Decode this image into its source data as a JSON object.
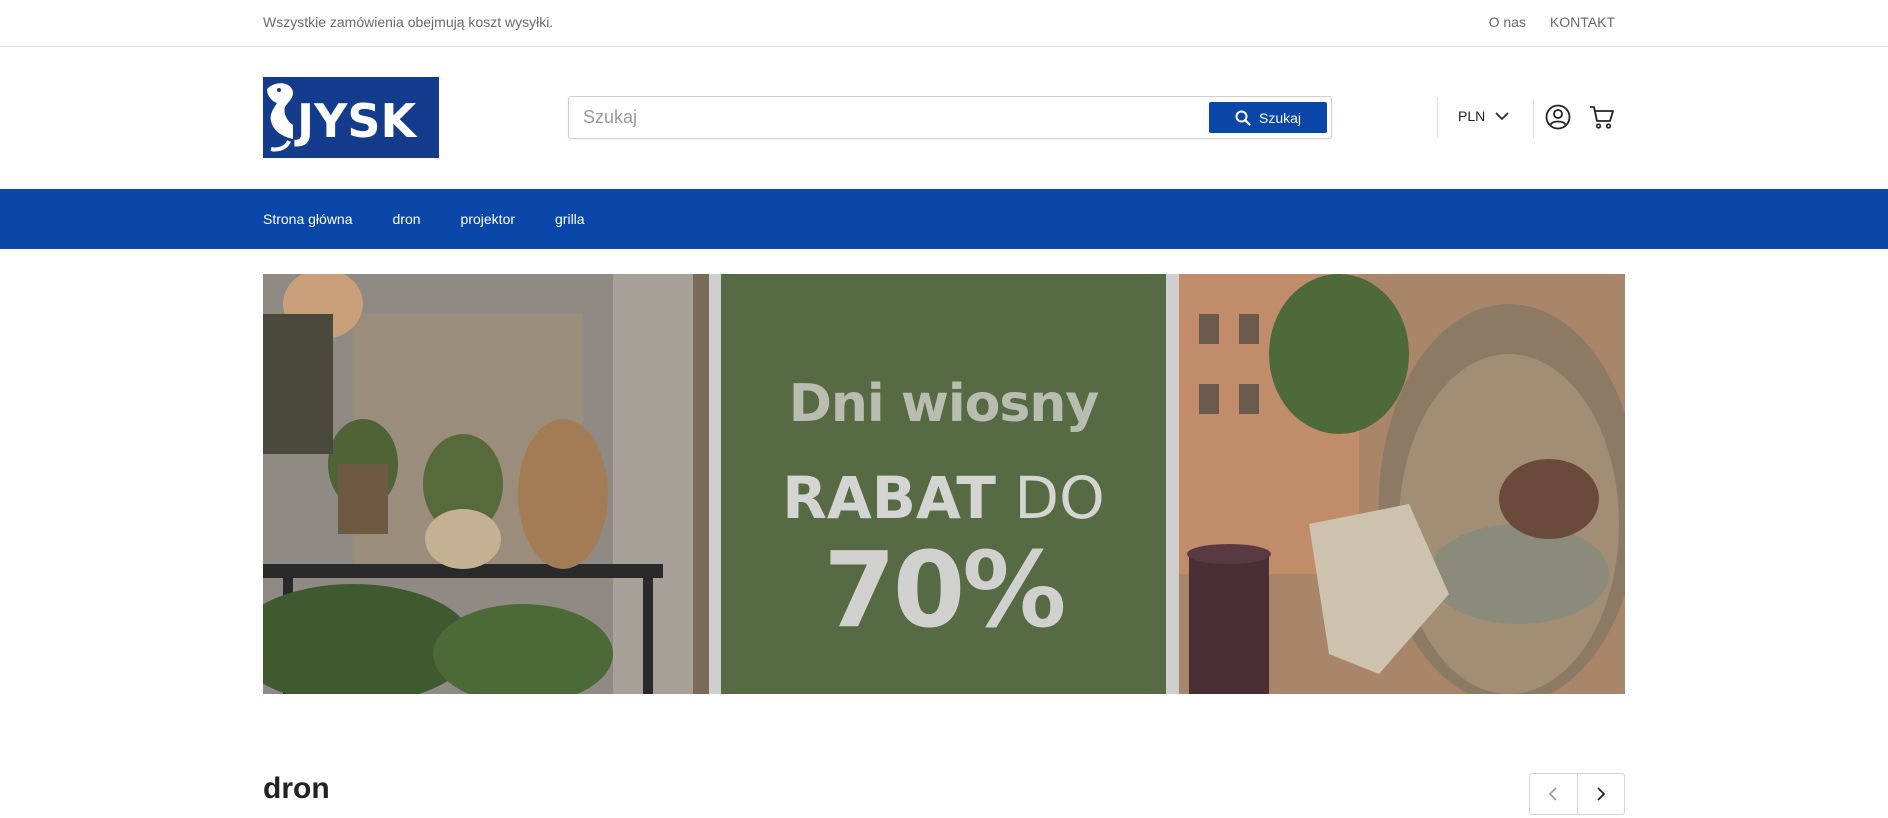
{
  "topbar": {
    "info": "Wszystkie zamówienia obejmują koszt wysyłki.",
    "links": [
      "O nas",
      "KONTAKT"
    ]
  },
  "header": {
    "logo_text": "JYSK",
    "search_placeholder": "Szukaj",
    "search_button": "Szukaj",
    "currency": "PLN",
    "icons": [
      "user-icon",
      "cart-icon"
    ]
  },
  "nav": {
    "items": [
      "Strona główna",
      "dron",
      "projektor",
      "grilla"
    ]
  },
  "banner": {
    "title": "Dni wiosny",
    "line_bold": "RABAT",
    "line_thin": "DO",
    "percent": "70%"
  },
  "section": {
    "title": "dron"
  },
  "colors": {
    "brand_blue": "#0a47a8",
    "logo_blue": "#143c8c",
    "promo_green": "#566a44"
  }
}
